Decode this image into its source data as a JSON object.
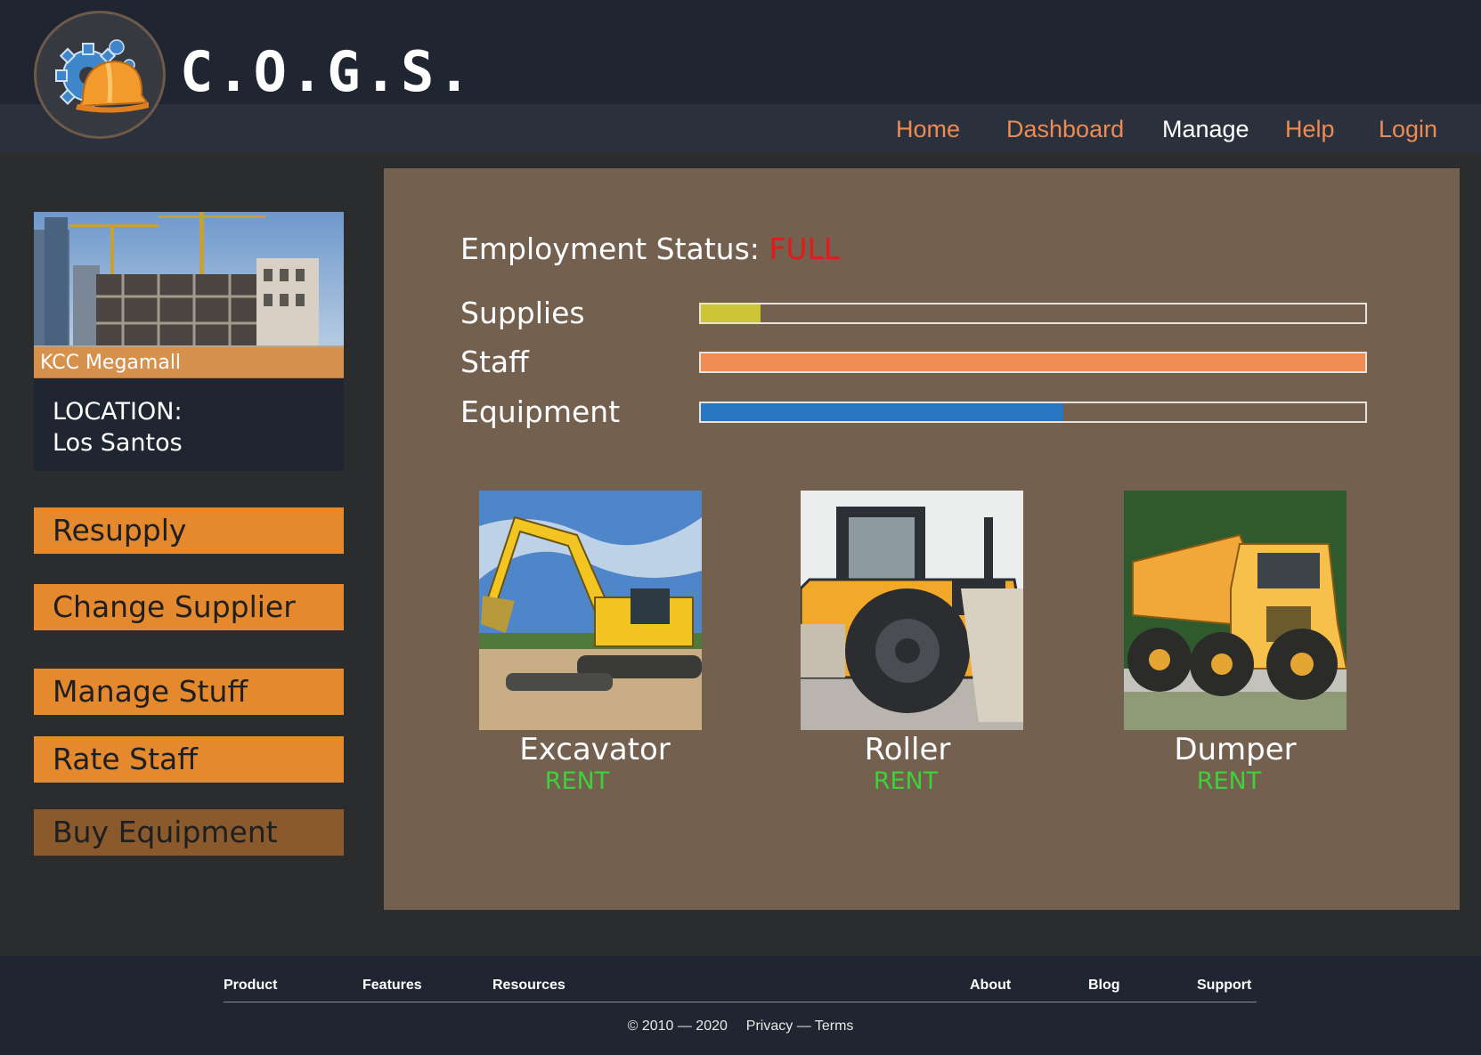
{
  "brand": {
    "name": "C.O.G.S.",
    "logo_icon": "gear-hardhat-icon"
  },
  "nav": {
    "items": [
      {
        "label": "Home",
        "active": false
      },
      {
        "label": "Dashboard",
        "active": false
      },
      {
        "label": "Manage",
        "active": true
      },
      {
        "label": "Help",
        "active": false
      },
      {
        "label": "Login",
        "active": false
      }
    ]
  },
  "site": {
    "name": "KCC Megamall",
    "location_label": "LOCATION:",
    "location_value": "Los Santos"
  },
  "sidebar": {
    "buttons": [
      {
        "label": "Resupply",
        "enabled": true
      },
      {
        "label": "Change Supplier",
        "enabled": true
      },
      {
        "label": "Manage Stuff",
        "enabled": true
      },
      {
        "label": "Rate Staff",
        "enabled": true
      },
      {
        "label": "Buy Equipment",
        "enabled": false
      }
    ]
  },
  "employment": {
    "label": "Employment Status:",
    "value": "FULL"
  },
  "resources": [
    {
      "label": "Supplies",
      "level": 0.09,
      "color": "#cdc534"
    },
    {
      "label": "Staff",
      "level": 1.0,
      "color": "#f28c55"
    },
    {
      "label": "Equipment",
      "level": 0.545,
      "color": "#2877c3"
    }
  ],
  "equipment": [
    {
      "name": "Excavator",
      "action": "RENT"
    },
    {
      "name": "Roller",
      "action": "RENT"
    },
    {
      "name": "Dumper",
      "action": "RENT"
    }
  ],
  "footer": {
    "links_left": [
      "Product",
      "Features",
      "Resources"
    ],
    "links_right": [
      "About",
      "Blog",
      "Support"
    ],
    "copyright": "© 2010 — 2020",
    "legal": "Privacy — Terms"
  },
  "colors": {
    "accent": "#e5892e",
    "nav_link": "#ef8a52",
    "status_full": "#e4191a",
    "rent": "#3ed13a",
    "panel": "#73604f",
    "header": "#202631"
  }
}
